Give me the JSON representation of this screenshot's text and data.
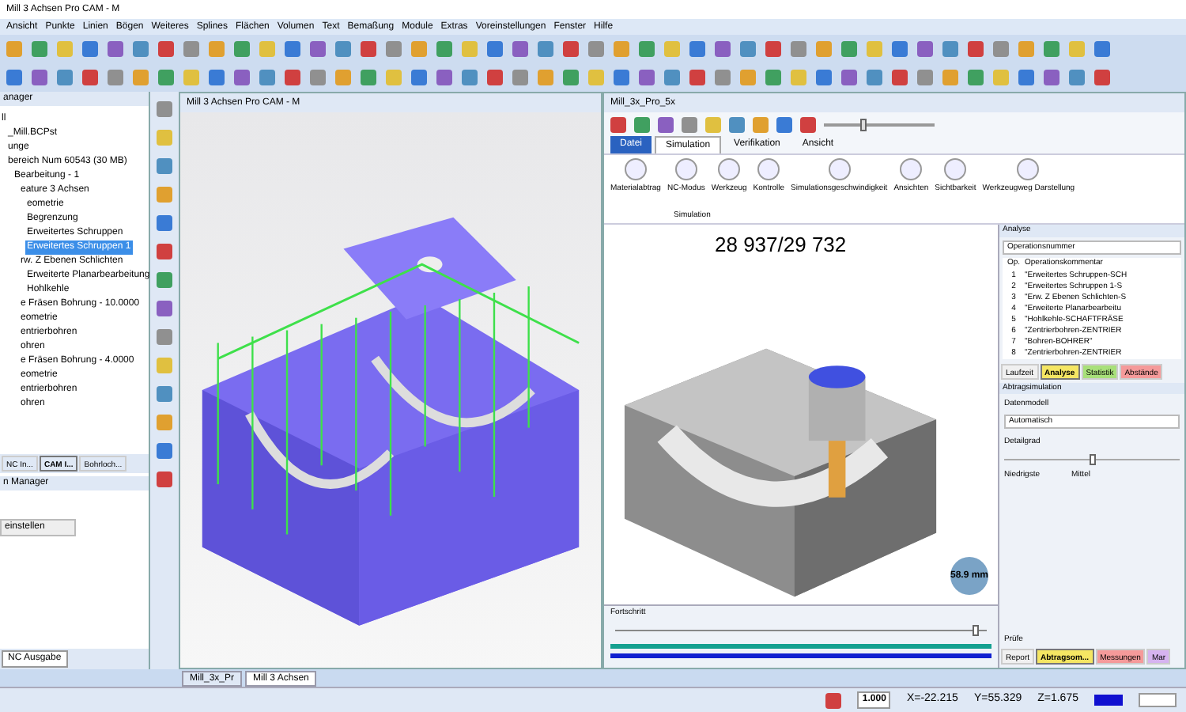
{
  "window": {
    "title": "Mill 3 Achsen Pro CAM - M"
  },
  "menu": [
    "Ansicht",
    "Punkte",
    "Linien",
    "Bögen",
    "Weiteres",
    "Splines",
    "Flächen",
    "Volumen",
    "Text",
    "Bemaßung",
    "Module",
    "Extras",
    "Voreinstellungen",
    "Fenster",
    "Hilfe"
  ],
  "left_panel": {
    "title": "anager",
    "tree": [
      {
        "label": "ll",
        "selected": false,
        "children": [
          {
            "label": "_Mill.BCPst",
            "selected": false
          },
          {
            "label": "unge",
            "selected": false
          },
          {
            "label": "bereich Num 60543 (30 MB)",
            "selected": false,
            "children": [
              {
                "label": "Bearbeitung - 1",
                "selected": false,
                "children": [
                  {
                    "label": "eature 3 Achsen",
                    "selected": false,
                    "children": [
                      {
                        "label": "eometrie",
                        "selected": false
                      },
                      {
                        "label": "Begrenzung",
                        "selected": false
                      },
                      {
                        "label": "Erweitertes Schruppen",
                        "selected": false
                      },
                      {
                        "label": "Erweitertes Schruppen 1",
                        "selected": true
                      }
                    ]
                  },
                  {
                    "label": "rw. Z Ebenen Schlichten",
                    "selected": false,
                    "children": [
                      {
                        "label": "Erweiterte Planarbearbeitung",
                        "selected": false
                      },
                      {
                        "label": "Hohlkehle",
                        "selected": false
                      }
                    ]
                  },
                  {
                    "label": "e Fräsen Bohrung - 10.0000",
                    "selected": false
                  },
                  {
                    "label": "eometrie",
                    "selected": false
                  },
                  {
                    "label": "entrierbohren",
                    "selected": false
                  },
                  {
                    "label": "ohren",
                    "selected": false
                  },
                  {
                    "label": "e Fräsen Bohrung - 4.0000",
                    "selected": false
                  },
                  {
                    "label": "eometrie",
                    "selected": false
                  },
                  {
                    "label": "entrierbohren",
                    "selected": false
                  },
                  {
                    "label": "ohren",
                    "selected": false
                  }
                ]
              }
            ]
          }
        ]
      }
    ],
    "tabs": [
      {
        "label": "NC In...",
        "selected": false
      },
      {
        "label": "CAM I...",
        "selected": true
      },
      {
        "label": "Bohrloch...",
        "selected": false
      }
    ]
  },
  "lower_panel": {
    "title": "n Manager",
    "button": "einstellen",
    "tab": "NC Ausgabe"
  },
  "document_window": {
    "title": "Mill 3 Achsen Pro CAM - M"
  },
  "simulation_window": {
    "title": "Mill_3x_Pro_5x",
    "speed": {
      "level": 0.35
    },
    "ribbon_tabs": [
      {
        "label": "Datei",
        "selected": false
      },
      {
        "label": "Simulation",
        "selected": true
      },
      {
        "label": "Verifikation",
        "selected": false
      },
      {
        "label": "Ansicht",
        "selected": false
      }
    ],
    "ribbon_buttons": [
      "Materialabtrag",
      "NC-Modus",
      "Werkzeug",
      "Kontrolle",
      "Simulationsgeschwindigkeit",
      "Ansichten",
      "Sichtbarkeit",
      "Werkzeugweg Darstellung"
    ],
    "group_label": "Simulation",
    "counter": "28 937/29 732",
    "distance": "58.9 mm",
    "progress": {
      "title": "Fortschritt",
      "level": 0.97,
      "bars": [
        {
          "level": 1
        },
        {
          "level": 1
        }
      ]
    }
  },
  "analysis": {
    "title": "Analyse",
    "dropdown": "Operationsnummer",
    "columns": [
      "Op.",
      "Operationskommentar"
    ],
    "rows": [
      [
        "1",
        "\"Erweitertes Schruppen-SCH"
      ],
      [
        "2",
        "\"Erweitertes Schruppen 1-S"
      ],
      [
        "3",
        "\"Erw. Z Ebenen Schlichten-S"
      ],
      [
        "4",
        "\"Erweiterte Planarbearbeitu"
      ],
      [
        "5",
        "\"Hohlkehle-SCHAFTFRÄSE"
      ],
      [
        "6",
        "\"Zentrierbohren-ZENTRIER"
      ],
      [
        "7",
        "\"Bohren-BOHRER\""
      ],
      [
        "8",
        "\"Zentrierbohren-ZENTRIER"
      ]
    ],
    "tabs": [
      {
        "label": "Laufzeit",
        "color": "#f0f0f0",
        "selected": false
      },
      {
        "label": "Analyse",
        "color": "#f5e663",
        "selected": true
      },
      {
        "label": "Statistik",
        "color": "#a8e07a",
        "selected": false
      },
      {
        "label": "Abstände",
        "color": "#f59a9a",
        "selected": false
      }
    ],
    "section": "Abtragsimulation",
    "model_label": "Datenmodell",
    "model_value": "Automatisch",
    "detail_label": "Detailgrad",
    "detail": {
      "level": 0.5
    },
    "detail_low": "Niedrigste",
    "detail_mid": "Mittel",
    "check_label": "Prüfe",
    "bottom_tabs": [
      {
        "label": "Report",
        "color": "#f0f0f0",
        "selected": false
      },
      {
        "label": "Abtragsom...",
        "color": "#f5e663",
        "selected": true
      },
      {
        "label": "Messungen",
        "color": "#f59a9a",
        "selected": false
      },
      {
        "label": "Mar",
        "color": "#d6b3f0",
        "selected": false
      }
    ]
  },
  "documents": [
    {
      "label": "Mill_3x_Pr",
      "selected": false
    },
    {
      "label": "Mill 3 Achsen",
      "selected": true
    }
  ],
  "status_bar": {
    "scale": "1.000",
    "x": "X=-22.215",
    "y": "Y=55.329",
    "z": "Z=1.675"
  }
}
